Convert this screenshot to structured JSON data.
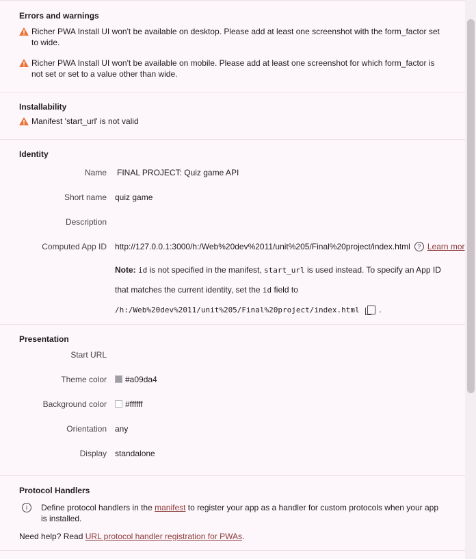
{
  "errors": {
    "title": "Errors and warnings",
    "items": [
      "Richer PWA Install UI won't be available on desktop. Please add at least one screenshot with the form_factor set to wide.",
      "Richer PWA Install UI won't be available on mobile. Please add at least one screenshot for which form_factor is not set or set to a value other than wide."
    ]
  },
  "installability": {
    "title": "Installability",
    "items": [
      "Manifest 'start_url' is not valid"
    ]
  },
  "identity": {
    "title": "Identity",
    "name_label": "Name",
    "name_value": "FINAL PROJECT: Quiz game API",
    "short_name_label": "Short name",
    "short_name_value": "quiz game",
    "description_label": "Description",
    "description_value": "",
    "app_id_label": "Computed App ID",
    "app_id_value": "http://127.0.0.1:3000/h:/Web%20dev%2011/unit%205/Final%20project/index.html",
    "learn_more": "Learn mor",
    "note_bold": "Note:",
    "note_code_id": "id",
    "note_text_1": " is not specified in the manifest, ",
    "note_code_start_url": "start_url",
    "note_text_2": " is used instead. To specify an App ID",
    "note_text_3": "that matches the current identity, set the ",
    "note_code_id_2": "id",
    "note_text_4": " field to",
    "suggested_id": "/h:/Web%20dev%2011/unit%205/Final%20project/index.html",
    "suggested_id_suffix": "."
  },
  "presentation": {
    "title": "Presentation",
    "start_url_label": "Start URL",
    "start_url_value": "",
    "theme_color_label": "Theme color",
    "theme_color_value": "#a09da4",
    "background_color_label": "Background color",
    "background_color_value": "#ffffff",
    "orientation_label": "Orientation",
    "orientation_value": "any",
    "display_label": "Display",
    "display_value": "standalone"
  },
  "protocol_handlers": {
    "title": "Protocol Handlers",
    "info_prefix": "Define protocol handlers in the ",
    "info_link": "manifest",
    "info_suffix": " to register your app as a handler for custom protocols when your app is installed.",
    "help_prefix": "Need help? Read ",
    "help_link": "URL protocol handler registration for PWAs",
    "help_suffix": "."
  },
  "colors": {
    "warning": "#e8743b",
    "link": "#8b3a3a",
    "divider": "#eadfe6",
    "background": "#fdf7fb"
  }
}
